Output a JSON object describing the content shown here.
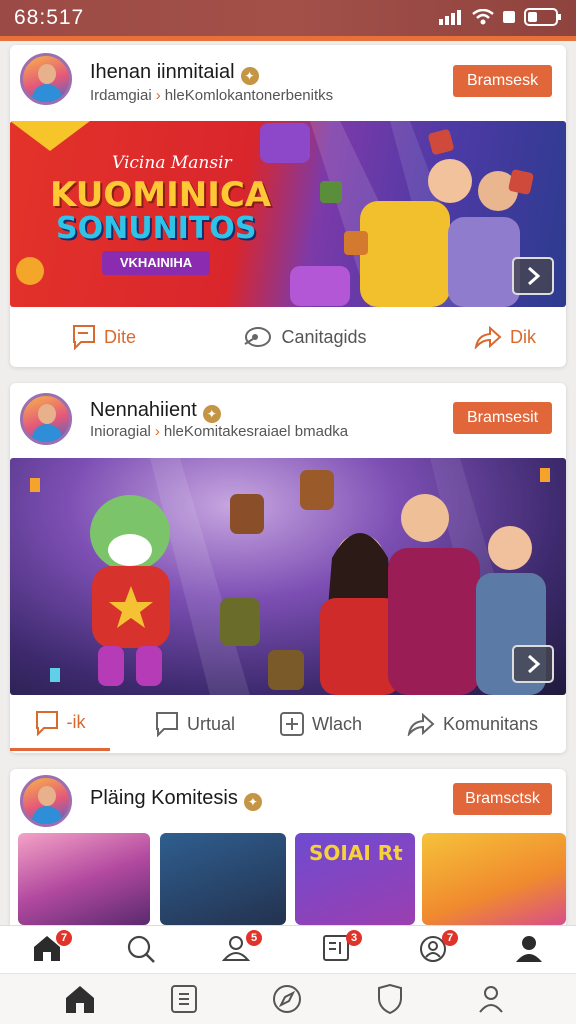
{
  "status_bar": {
    "time": "68:517"
  },
  "posts": [
    {
      "title": "Ihenan iinmitaial",
      "subtitle_left": "Irdamgiai",
      "subtitle_right": "hleKomlokantonerbenitks",
      "follow_label": "Bramsesk",
      "banner": {
        "kicker": "Vicina Mansir",
        "headline_1": "KUOMINICA",
        "headline_2": "SONUNITOS",
        "tag": "VKHAINIHA"
      },
      "actions": [
        {
          "label": "Dite",
          "icon": "chat-bubble-icon"
        },
        {
          "label": "Canitagids",
          "icon": "share-link-icon"
        },
        {
          "label": "Dik",
          "icon": "share-arrow-icon"
        }
      ]
    },
    {
      "title": "Nennahiient",
      "subtitle_left": "Inioragial",
      "subtitle_right": "hleKomitakesraiael bmadka",
      "follow_label": "Bramsesit",
      "actions": [
        {
          "label": "-ik",
          "icon": "chat-bubble-icon"
        },
        {
          "label": "Urtual",
          "icon": "comment-icon"
        },
        {
          "label": "Wlach",
          "icon": "plus-box-icon"
        },
        {
          "label": "Komunitans",
          "icon": "share-arrow-icon"
        }
      ]
    },
    {
      "title": "Pläing Komitesis",
      "follow_label": "Bramsctsk",
      "thumbnail_text": "SOIAI Rt"
    }
  ],
  "nav_top": [
    {
      "icon": "home-icon",
      "badge": "7"
    },
    {
      "icon": "search-icon",
      "badge": ""
    },
    {
      "icon": "users-icon",
      "badge": "5"
    },
    {
      "icon": "news-icon",
      "badge": "3"
    },
    {
      "icon": "community-icon",
      "badge": "7"
    },
    {
      "icon": "profile-icon",
      "badge": ""
    }
  ],
  "nav_bottom": [
    {
      "icon": "home-icon"
    },
    {
      "icon": "list-icon"
    },
    {
      "icon": "compass-icon"
    },
    {
      "icon": "shield-icon"
    },
    {
      "icon": "account-icon"
    }
  ],
  "colors": {
    "accent": "#e1673a",
    "status_bar": "#a04c47"
  }
}
